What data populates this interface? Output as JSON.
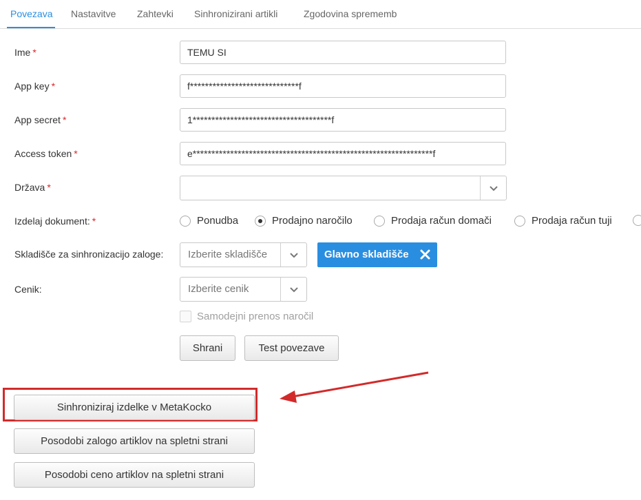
{
  "tabs": [
    {
      "label": "Povezava",
      "active": true
    },
    {
      "label": "Nastavitve"
    },
    {
      "label": "Zahtevki"
    },
    {
      "label": "Sinhronizirani artikli"
    },
    {
      "label": "Zgodovina sprememb"
    }
  ],
  "form": {
    "ime": {
      "label": "Ime",
      "value": "TEMU SI",
      "required": "*"
    },
    "app_key": {
      "label": "App key",
      "value": "f*****************************f",
      "required": "*"
    },
    "app_secret": {
      "label": "App secret",
      "value": "1*************************************f",
      "required": "*"
    },
    "access_token": {
      "label": "Access token",
      "value": "e****************************************************************f",
      "required": "*"
    },
    "drzava": {
      "label": "Država",
      "value": "",
      "required": "*"
    },
    "izdelaj_dokument": {
      "label": "Izdelaj dokument:",
      "required": "*",
      "options": [
        "Ponudba",
        "Prodajno naročilo",
        "Prodaja račun domači",
        "Prodaja račun tuji"
      ],
      "selected": "Prodajno naročilo"
    },
    "skladisce": {
      "label": "Skladišče za sinhronizacijo zaloge:",
      "placeholder": "Izberite skladišče",
      "tag": "Glavno skladišče"
    },
    "cenik": {
      "label": "Cenik:",
      "placeholder": "Izberite cenik"
    },
    "samodejni": {
      "label": "Samodejni prenos naročil",
      "checked": false
    }
  },
  "buttons": {
    "save": "Shrani",
    "test": "Test povezave",
    "sync": "Sinhroniziraj izdelke v MetaKocko",
    "update_stock": "Posodobi zalogo artiklov na spletni strani",
    "update_price": "Posodobi ceno artiklov na spletni strani"
  },
  "colors": {
    "accent": "#2a8ee0",
    "required": "#d9262b",
    "annotation": "#d22a2a"
  },
  "icons": {
    "dropdown": "chevron-down-icon",
    "remove_tag": "close-icon"
  }
}
